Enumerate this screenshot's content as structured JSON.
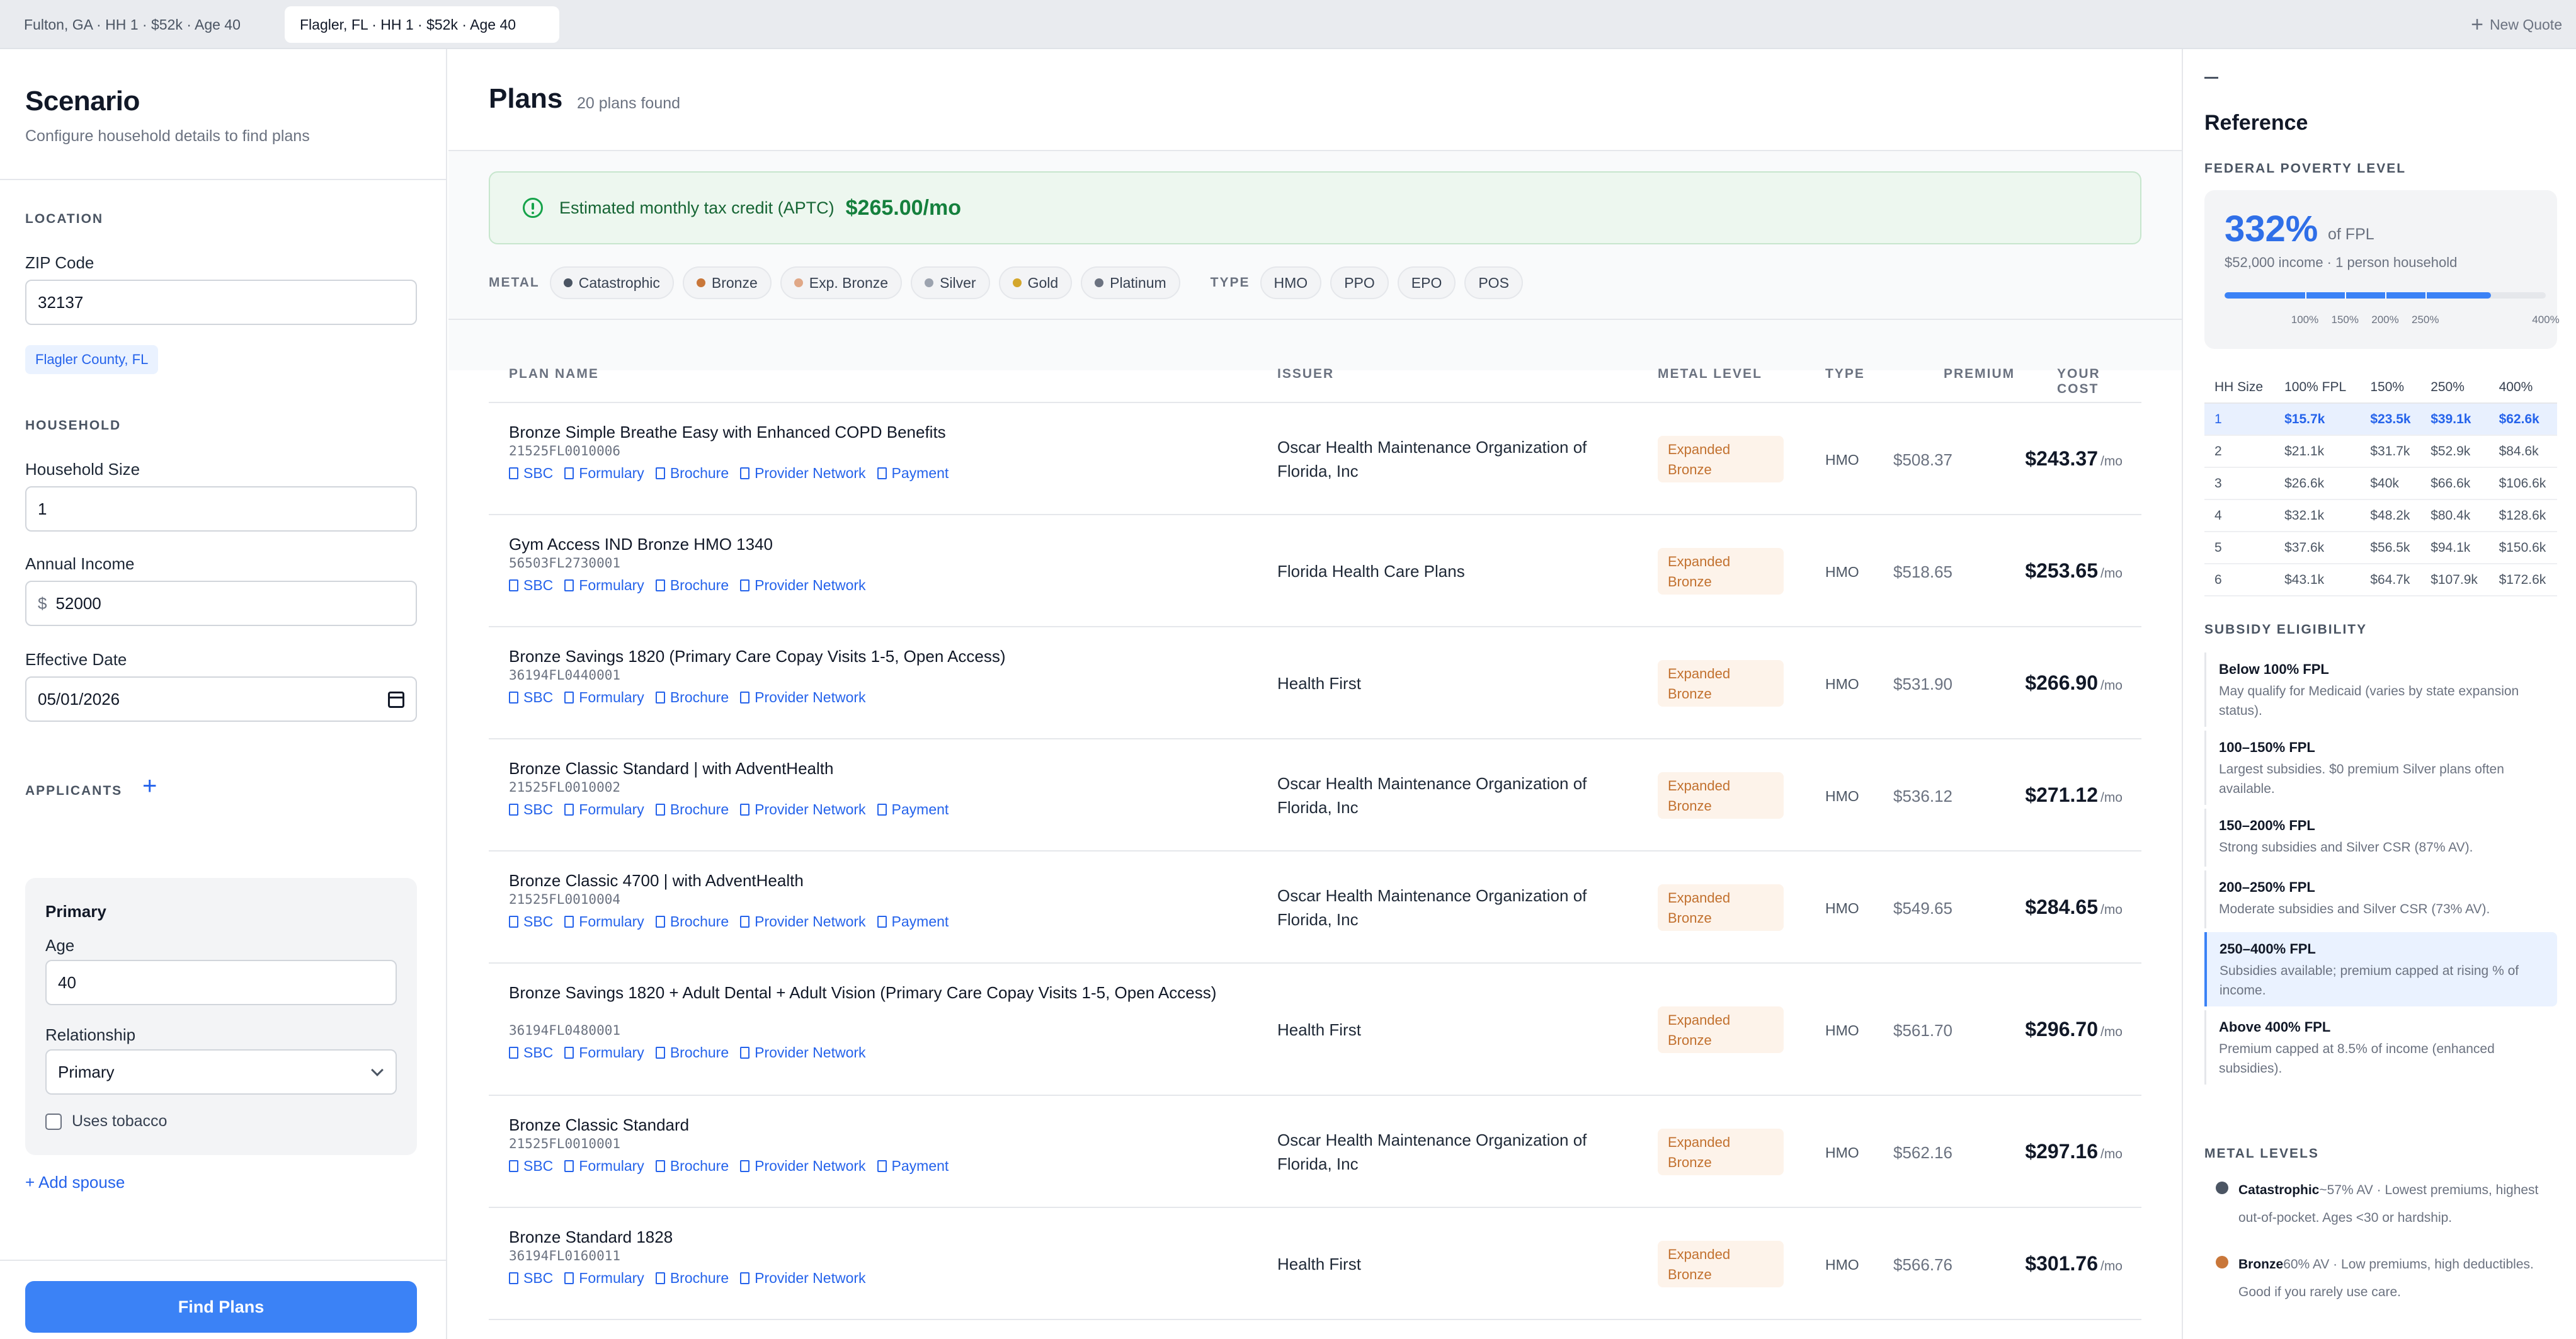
{
  "tabs": [
    {
      "label": "Fulton, GA · HH 1 · $52k · Age 40"
    },
    {
      "label": "Flagler, FL · HH 1 · $52k · Age 40"
    }
  ],
  "new_quote_label": "New Quote",
  "scenario": {
    "title": "Scenario",
    "subtitle": "Configure household details to find plans",
    "location_label": "LOCATION",
    "zip_label": "ZIP Code",
    "zip_value": "32137",
    "county": "Flagler County, FL",
    "household_label": "HOUSEHOLD",
    "hh_size_label": "Household Size",
    "hh_size_value": "1",
    "income_label": "Annual Income",
    "income_prefix": "$",
    "income_value": "52000",
    "date_label": "Effective Date",
    "date_value": "05/01/2026",
    "applicants_label": "APPLICANTS",
    "applicant": {
      "title": "Primary",
      "age_label": "Age",
      "age_value": "40",
      "relationship_label": "Relationship",
      "relationship_value": "Primary",
      "tobacco_label": "Uses tobacco"
    },
    "add_spouse": "+ Add spouse",
    "find_button": "Find Plans"
  },
  "plans": {
    "title": "Plans",
    "count_text": "20 plans found",
    "aptc_text": "Estimated monthly tax credit (APTC)",
    "aptc_amount": "$265.00/mo",
    "metal_label": "METAL",
    "metal_filters": [
      {
        "label": "Catastrophic",
        "color": "#4b5563"
      },
      {
        "label": "Bronze",
        "color": "#c9773a"
      },
      {
        "label": "Exp. Bronze",
        "color": "#e0a887"
      },
      {
        "label": "Silver",
        "color": "#9ca3af"
      },
      {
        "label": "Gold",
        "color": "#d4a72c"
      },
      {
        "label": "Platinum",
        "color": "#6b7280"
      }
    ],
    "type_label": "TYPE",
    "type_filters": [
      "HMO",
      "PPO",
      "EPO",
      "POS"
    ],
    "columns": {
      "name": "PLAN NAME",
      "issuer": "ISSUER",
      "metal": "METAL LEVEL",
      "type": "TYPE",
      "premium": "PREMIUM",
      "cost": "YOUR COST"
    },
    "per_month": "/mo",
    "rows": [
      {
        "name": "Bronze Simple Breathe Easy with Enhanced COPD Benefits",
        "id": "21525FL0010006",
        "links": [
          "SBC",
          "Formulary",
          "Brochure",
          "Provider Network",
          "Payment"
        ],
        "issuer": "Oscar Health Maintenance Organization of Florida, Inc",
        "metal": "Expanded Bronze",
        "type": "HMO",
        "premium": "$508.37",
        "cost": "$243.37"
      },
      {
        "name": "Gym Access IND Bronze HMO 1340",
        "id": "56503FL2730001",
        "links": [
          "SBC",
          "Formulary",
          "Brochure",
          "Provider Network"
        ],
        "issuer": "Florida Health Care Plans",
        "metal": "Expanded Bronze",
        "type": "HMO",
        "premium": "$518.65",
        "cost": "$253.65"
      },
      {
        "name": "Bronze Savings 1820 (Primary Care Copay Visits 1-5, Open Access)",
        "id": "36194FL0440001",
        "links": [
          "SBC",
          "Formulary",
          "Brochure",
          "Provider Network"
        ],
        "issuer": "Health First",
        "metal": "Expanded Bronze",
        "type": "HMO",
        "premium": "$531.90",
        "cost": "$266.90"
      },
      {
        "name": "Bronze Classic Standard | with AdventHealth",
        "id": "21525FL0010002",
        "links": [
          "SBC",
          "Formulary",
          "Brochure",
          "Provider Network",
          "Payment"
        ],
        "issuer": "Oscar Health Maintenance Organization of Florida, Inc",
        "metal": "Expanded Bronze",
        "type": "HMO",
        "premium": "$536.12",
        "cost": "$271.12"
      },
      {
        "name": "Bronze Classic 4700 | with AdventHealth",
        "id": "21525FL0010004",
        "links": [
          "SBC",
          "Formulary",
          "Brochure",
          "Provider Network",
          "Payment"
        ],
        "issuer": "Oscar Health Maintenance Organization of Florida, Inc",
        "metal": "Expanded Bronze",
        "type": "HMO",
        "premium": "$549.65",
        "cost": "$284.65"
      },
      {
        "name": "Bronze Savings 1820 + Adult Dental + Adult Vision (Primary Care Copay Visits 1-5, Open Access)",
        "id": "36194FL0480001",
        "links": [
          "SBC",
          "Formulary",
          "Brochure",
          "Provider Network"
        ],
        "issuer": "Health First",
        "metal": "Expanded Bronze",
        "type": "HMO",
        "premium": "$561.70",
        "cost": "$296.70"
      },
      {
        "name": "Bronze Classic Standard",
        "id": "21525FL0010001",
        "links": [
          "SBC",
          "Formulary",
          "Brochure",
          "Provider Network",
          "Payment"
        ],
        "issuer": "Oscar Health Maintenance Organization of Florida, Inc",
        "metal": "Expanded Bronze",
        "type": "HMO",
        "premium": "$562.16",
        "cost": "$297.16"
      },
      {
        "name": "Bronze Standard 1828",
        "id": "36194FL0160011",
        "links": [
          "SBC",
          "Formulary",
          "Brochure",
          "Provider Network"
        ],
        "issuer": "Health First",
        "metal": "Expanded Bronze",
        "type": "HMO",
        "premium": "$566.76",
        "cost": "$301.76"
      }
    ]
  },
  "reference": {
    "title": "Reference",
    "fpl_label": "FEDERAL POVERTY LEVEL",
    "fpl_percent": "332%",
    "fpl_of": "of FPL",
    "fpl_fill_fraction": 0.83,
    "fpl_sub": "$52,000 income · 1 person household",
    "fpl_ticks": [
      {
        "label": "100%",
        "frac": 0.25
      },
      {
        "label": "150%",
        "frac": 0.375
      },
      {
        "label": "200%",
        "frac": 0.5
      },
      {
        "label": "250%",
        "frac": 0.625
      },
      {
        "label": "400%",
        "frac": 1.0
      }
    ],
    "fpl_table": {
      "headers": [
        "HH Size",
        "100% FPL",
        "150%",
        "250%",
        "400%"
      ],
      "rows": [
        [
          "1",
          "$15.7k",
          "$23.5k",
          "$39.1k",
          "$62.6k"
        ],
        [
          "2",
          "$21.1k",
          "$31.7k",
          "$52.9k",
          "$84.6k"
        ],
        [
          "3",
          "$26.6k",
          "$40k",
          "$66.6k",
          "$106.6k"
        ],
        [
          "4",
          "$32.1k",
          "$48.2k",
          "$80.4k",
          "$128.6k"
        ],
        [
          "5",
          "$37.6k",
          "$56.5k",
          "$94.1k",
          "$150.6k"
        ],
        [
          "6",
          "$43.1k",
          "$64.7k",
          "$107.9k",
          "$172.6k"
        ]
      ]
    },
    "subsidy_label": "SUBSIDY ELIGIBILITY",
    "subsidy_items": [
      {
        "title": "Below 100% FPL",
        "desc": "May qualify for Medicaid (varies by state expansion status)."
      },
      {
        "title": "100–150% FPL",
        "desc": "Largest subsidies. $0 premium Silver plans often available."
      },
      {
        "title": "150–200% FPL",
        "desc": "Strong subsidies and Silver CSR (87% AV)."
      },
      {
        "title": "200–250% FPL",
        "desc": "Moderate subsidies and Silver CSR (73% AV)."
      },
      {
        "title": "250–400% FPL",
        "desc": "Subsidies available; premium capped at rising % of income."
      },
      {
        "title": "Above 400% FPL",
        "desc": "Premium capped at 8.5% of income (enhanced subsidies)."
      }
    ],
    "metal_levels_label": "METAL LEVELS",
    "metal_levels": [
      {
        "name": "Catastrophic",
        "desc": "~57% AV · Lowest premiums, highest out-of-pocket. Ages <30 or hardship.",
        "color": "#4b5563"
      },
      {
        "name": "Bronze",
        "desc": "60% AV · Low premiums, high deductibles. Good if you rarely use care.",
        "color": "#c9773a"
      }
    ]
  }
}
